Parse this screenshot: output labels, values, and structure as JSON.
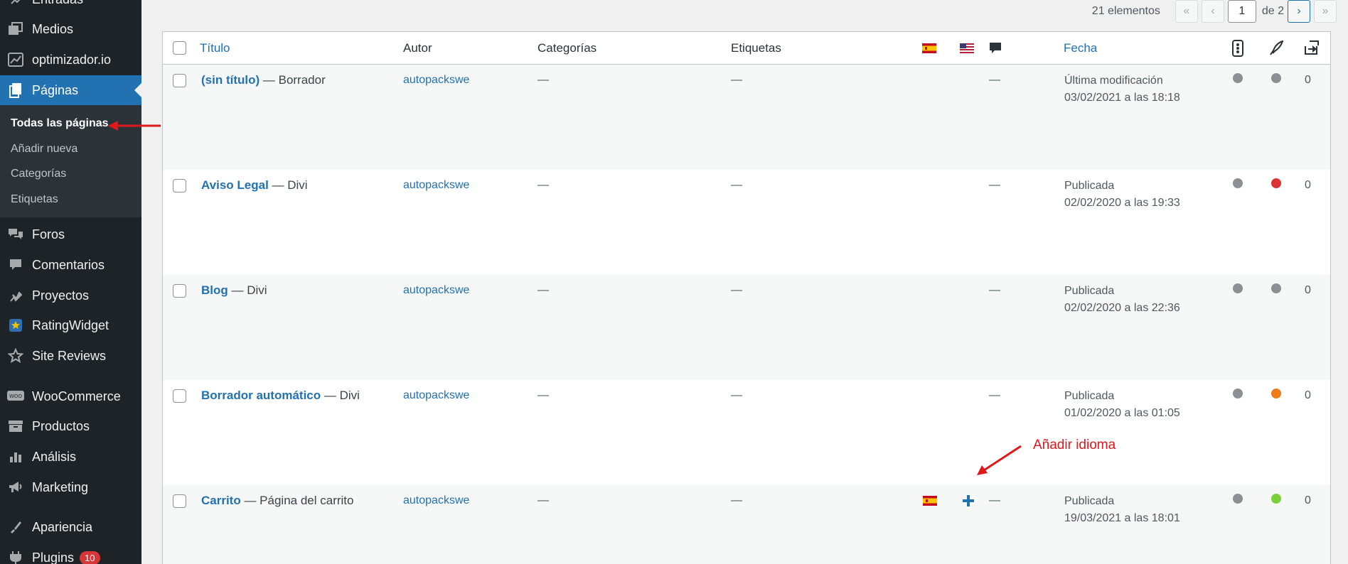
{
  "sidebar": {
    "items": [
      {
        "label": "Entradas",
        "icon": "pin-icon"
      },
      {
        "label": "Medios",
        "icon": "media-icon"
      },
      {
        "label": "optimizador.io",
        "icon": "optimizer-icon"
      },
      {
        "label": "Páginas",
        "icon": "pages-icon"
      },
      {
        "label": "Foros",
        "icon": "forums-icon"
      },
      {
        "label": "Comentarios",
        "icon": "comments-icon"
      },
      {
        "label": "Proyectos",
        "icon": "projects-icon"
      },
      {
        "label": "RatingWidget",
        "icon": "rating-widget-icon"
      },
      {
        "label": "Site Reviews",
        "icon": "star-icon"
      },
      {
        "label": "WooCommerce",
        "icon": "woocommerce-icon"
      },
      {
        "label": "Productos",
        "icon": "products-icon"
      },
      {
        "label": "Análisis",
        "icon": "analytics-icon"
      },
      {
        "label": "Marketing",
        "icon": "megaphone-icon"
      },
      {
        "label": "Apariencia",
        "icon": "appearance-icon"
      },
      {
        "label": "Plugins",
        "icon": "plugins-icon",
        "badge": "10"
      }
    ],
    "submenu": [
      "Todas las páginas",
      "Añadir nueva",
      "Categorías",
      "Etiquetas"
    ]
  },
  "pagination": {
    "count": "21 elementos",
    "first": "«",
    "prev": "‹",
    "current_page": "1",
    "of_total": "de 2",
    "next": "›",
    "last": "»"
  },
  "table": {
    "headers": {
      "title": "Título",
      "author": "Autor",
      "categories": "Categorías",
      "tags": "Etiquetas",
      "date": "Fecha"
    },
    "rows": [
      {
        "title": "(sin título)",
        "state": " — Borrador",
        "author": "autopackswe",
        "categories": "—",
        "tags": "—",
        "comments": "—",
        "date_status": "Última modificación",
        "date": "03/02/2021 a las 18:18",
        "seo_color": "#8c8f94",
        "readability_color": "#8c8f94",
        "links": "0"
      },
      {
        "title": "Aviso Legal",
        "state": " — Divi",
        "author": "autopackswe",
        "categories": "—",
        "tags": "—",
        "comments": "—",
        "date_status": "Publicada",
        "date": "02/02/2020 a las 19:33",
        "seo_color": "#8c8f94",
        "readability_color": "#dc3232",
        "links": "0"
      },
      {
        "title": "Blog",
        "state": " — Divi",
        "author": "autopackswe",
        "categories": "—",
        "tags": "—",
        "comments": "—",
        "date_status": "Publicada",
        "date": "02/02/2020 a las 22:36",
        "seo_color": "#8c8f94",
        "readability_color": "#8c8f94",
        "links": "0"
      },
      {
        "title": "Borrador automático",
        "state": " — Divi",
        "author": "autopackswe",
        "categories": "—",
        "tags": "—",
        "comments": "—",
        "date_status": "Publicada",
        "date": "01/02/2020 a las 01:05",
        "seo_color": "#8c8f94",
        "readability_color": "#ee7c1b",
        "links": "0"
      },
      {
        "title": "Carrito",
        "state": " — Página del carrito",
        "author": "autopackswe",
        "categories": "—",
        "tags": "—",
        "comments": "—",
        "date_status": "Publicada",
        "date": "19/03/2021 a las 18:01",
        "seo_color": "#8c8f94",
        "readability_color": "#7ad03a",
        "links": "0"
      }
    ]
  },
  "annotations": {
    "add_language": "Añadir idioma"
  },
  "colors": {
    "accent": "#2271b1",
    "sidebar_bg": "#1d2327",
    "annotation_red": "#e0181b"
  }
}
